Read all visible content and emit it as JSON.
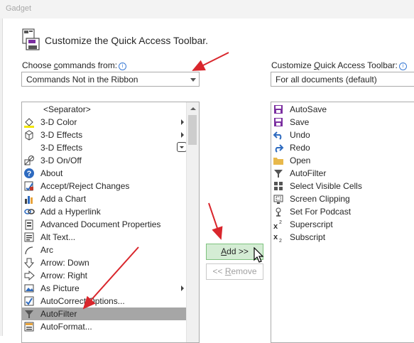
{
  "window": {
    "title": "Gadget"
  },
  "header": {
    "title": "Customize the Quick Access Toolbar."
  },
  "left": {
    "label_pre": "Choose ",
    "label_key": "c",
    "label_post": "ommands from:",
    "info": "i",
    "combo_value": "Commands Not in the Ribbon",
    "items": [
      {
        "label": "<Separator>",
        "icon": "none"
      },
      {
        "label": "3-D Color",
        "icon": "paint-bucket-icon"
      },
      {
        "label": "3-D Effects",
        "icon": "cube-icon"
      },
      {
        "label": "3-D Effects",
        "icon": "none"
      },
      {
        "label": "3-D On/Off",
        "icon": "shape-3d-icon"
      },
      {
        "label": "About",
        "icon": "help-circle-icon"
      },
      {
        "label": "Accept/Reject Changes",
        "icon": "track-changes-icon"
      },
      {
        "label": "Add a Chart",
        "icon": "bar-chart-icon"
      },
      {
        "label": "Add a Hyperlink",
        "icon": "hyperlink-icon"
      },
      {
        "label": "Advanced Document Properties",
        "icon": "properties-icon"
      },
      {
        "label": "Alt Text...",
        "icon": "alt-text-icon"
      },
      {
        "label": "Arc",
        "icon": "arc-icon"
      },
      {
        "label": "Arrow: Down",
        "icon": "arrow-down-icon"
      },
      {
        "label": "Arrow: Right",
        "icon": "arrow-right-icon"
      },
      {
        "label": "As Picture",
        "icon": "picture-icon"
      },
      {
        "label": "AutoCorrect Options...",
        "icon": "autocorrect-icon"
      },
      {
        "label": "AutoFilter",
        "icon": "filter-icon"
      },
      {
        "label": "AutoFormat...",
        "icon": "autoformat-icon"
      }
    ]
  },
  "right": {
    "label_pre": "Customize ",
    "label_key": "Q",
    "label_post": "uick Access Toolbar:",
    "info": "i",
    "combo_value": "For all documents (default)",
    "items": [
      {
        "label": "AutoSave",
        "icon": "autosave-icon"
      },
      {
        "label": "Save",
        "icon": "save-icon"
      },
      {
        "label": "Undo",
        "icon": "undo-icon"
      },
      {
        "label": "Redo",
        "icon": "redo-icon"
      },
      {
        "label": "Open",
        "icon": "folder-icon"
      },
      {
        "label": "AutoFilter",
        "icon": "filter-icon"
      },
      {
        "label": "Select Visible Cells",
        "icon": "select-cells-icon"
      },
      {
        "label": "Screen Clipping",
        "icon": "screen-clipping-icon"
      },
      {
        "label": "Set For Podcast",
        "icon": "podcast-icon"
      },
      {
        "label": "Superscript",
        "icon": "superscript-icon"
      },
      {
        "label": "Subscript",
        "icon": "subscript-icon"
      }
    ]
  },
  "buttons": {
    "add_key": "A",
    "add_rest": "dd >>",
    "remove_pre": "<< ",
    "remove_key": "R",
    "remove_rest": "emove"
  },
  "colors": {
    "annotation_arrow": "#d9262c",
    "selection": "#a6a6a6",
    "add_button": "#d4ecd4"
  }
}
